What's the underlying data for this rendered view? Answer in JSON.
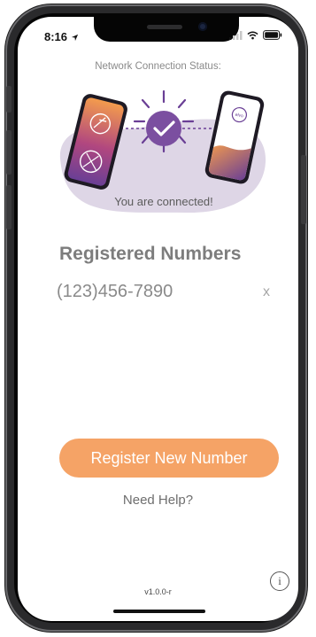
{
  "status_bar": {
    "time": "8:16"
  },
  "network": {
    "title": "Network Connection Status:",
    "status_text": "You are connected!",
    "colors": {
      "blob": "#ded6e6",
      "check": "#7b4fa0",
      "orange": "#f39b4d",
      "purple": "#6a3f95"
    }
  },
  "registered": {
    "title": "Registered Numbers",
    "numbers": [
      "(123)456-7890"
    ],
    "remove_label": "x"
  },
  "actions": {
    "register_label": "Register New Number",
    "help_label": "Need Help?"
  },
  "footer": {
    "version": "v1.0.0-r",
    "info_label": "i"
  },
  "accent_color": "#f5a366"
}
